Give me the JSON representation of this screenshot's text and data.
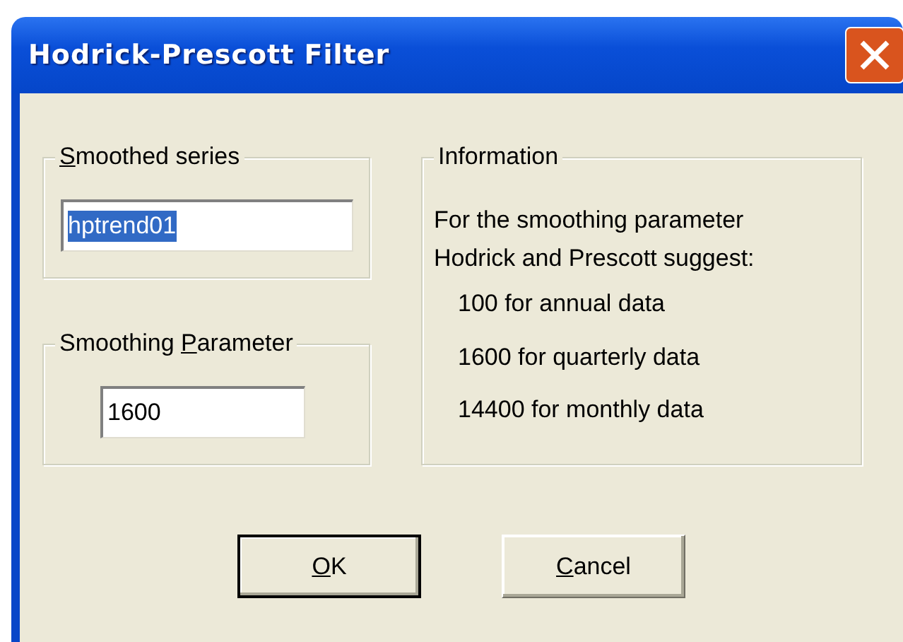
{
  "window": {
    "title": "Hodrick-Prescott Filter"
  },
  "smoothed_series": {
    "label": {
      "key": "S",
      "post": "moothed series"
    },
    "value": "hptrend01",
    "selected": true
  },
  "smoothing_parameter": {
    "label": {
      "pre": "Smoothing ",
      "key": "P",
      "post": "arameter"
    },
    "value": "1600",
    "selected": false
  },
  "information": {
    "title": "Information",
    "intro": "For the smoothing parameter Hodrick and Prescott suggest:",
    "items": [
      "100 for annual data",
      "1600 for quarterly data",
      "14400 for monthly data"
    ]
  },
  "buttons": [
    {
      "label": {
        "key": "O",
        "post": "K"
      },
      "default": true
    },
    {
      "label": {
        "key": "C",
        "post": "ancel"
      },
      "default": false
    }
  ]
}
